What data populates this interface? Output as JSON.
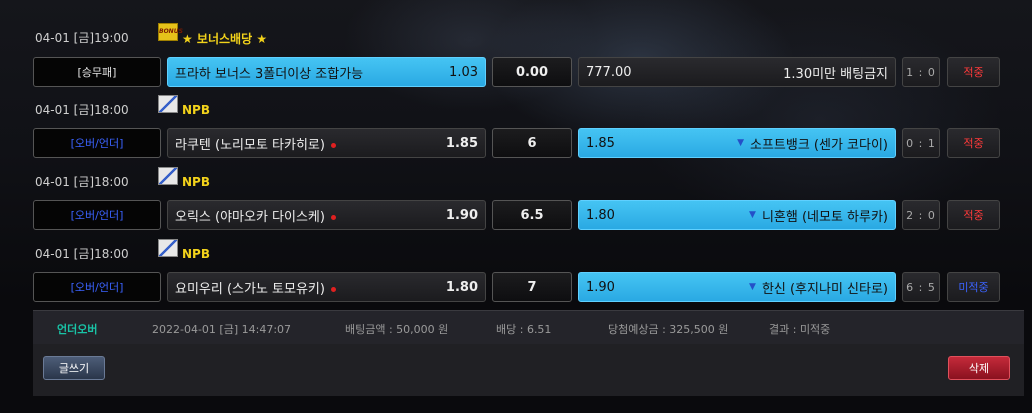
{
  "games": [
    {
      "datetime": "04-01 [금]19:00",
      "league": "★ 보너스배당 ★",
      "league_icon": "bonus-icon",
      "type": "[승무패]",
      "home": {
        "name": "프라하 보너스 3폴더이상 조합가능",
        "odds": "1.03"
      },
      "mid": "0.00",
      "away": {
        "name": "1.30미만 배팅금지",
        "odds": "777.00"
      },
      "score": "1 : 0",
      "result": "적중",
      "selected": "home"
    },
    {
      "datetime": "04-01 [금]18:00",
      "league": "NPB",
      "league_icon": "npb-flag-icon",
      "type": "[오버/언더]",
      "home": {
        "name": "라쿠텐 (노리모토 타카히로)",
        "odds": "1.85"
      },
      "mid": "6",
      "away": {
        "name": "소프트뱅크 (센가 코다이)",
        "odds": "1.85"
      },
      "score": "0 : 1",
      "result": "적중",
      "selected": "away"
    },
    {
      "datetime": "04-01 [금]18:00",
      "league": "NPB",
      "league_icon": "npb-flag-icon",
      "type": "[오버/언더]",
      "home": {
        "name": "오릭스 (야마오카 다이스케)",
        "odds": "1.90"
      },
      "mid": "6.5",
      "away": {
        "name": "니혼햄 (네모토 하루카)",
        "odds": "1.80"
      },
      "score": "2 : 0",
      "result": "적중",
      "selected": "away"
    },
    {
      "datetime": "04-01 [금]18:00",
      "league": "NPB",
      "league_icon": "npb-flag-icon",
      "type": "[오버/언더]",
      "home": {
        "name": "요미우리 (스가노 토모유키)",
        "odds": "1.80"
      },
      "mid": "7",
      "away": {
        "name": "한신 (후지나미 신타로)",
        "odds": "1.90"
      },
      "score": "6 : 5",
      "result": "미적중",
      "selected": "away"
    }
  ],
  "summary": {
    "kind": "언더오버",
    "datetime": "2022-04-01 [금] 14:47:07",
    "bet_amount": "배팅금액 : 50,000 원",
    "odds": "배당 : 6.51",
    "expected": "당첨예상금 : 325,500 원",
    "result": "결과 : 미적중"
  },
  "buttons": {
    "write": "글쓰기",
    "delete": "삭제"
  },
  "colors": {
    "selected": "#2aa9e3",
    "hit": "#ff3a3a",
    "miss": "#3b63ff",
    "league": "#f2d21b"
  }
}
